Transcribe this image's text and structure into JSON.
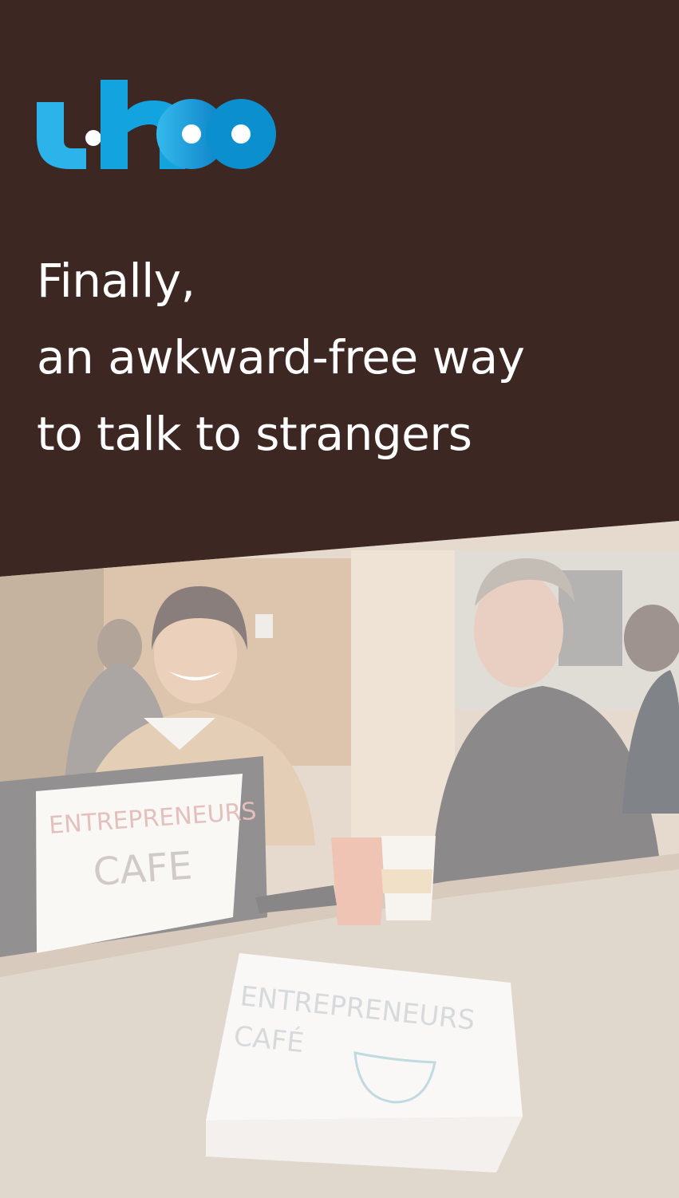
{
  "brand": {
    "logo_text": "uhoo",
    "logo_color": "#1ea6e0",
    "logo_color_dark": "#0b86c8"
  },
  "headline": {
    "line1": "Finally,",
    "line2": "an awkward-free way",
    "line3": "to talk to strangers"
  },
  "photo": {
    "laptop_sign": {
      "line1": "ENTREPRENEURS",
      "line2": "CAFE"
    },
    "table_sign": {
      "line1": "ENTREPRENEURS",
      "line2": "CAFÉ"
    }
  },
  "colors": {
    "background": "#3d2722",
    "text": "#ffffff"
  }
}
